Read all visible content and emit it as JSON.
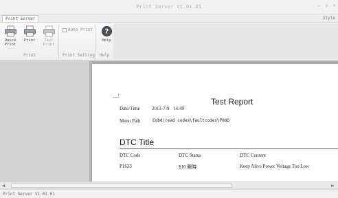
{
  "window": {
    "title": "Print Server V1.01.01"
  },
  "tabs": [
    {
      "label": "Print Server"
    }
  ],
  "style_label": "Style",
  "ribbon": {
    "quick_print": "Quick Print",
    "print": "Print",
    "text_print": "Text Print",
    "auto_print": "Auto Print",
    "help": "Help",
    "groups": [
      "Print",
      "Print Setting",
      "Help"
    ]
  },
  "report": {
    "title": "Test Report",
    "date_label": "Date/Time",
    "date_value": "2011-7-9",
    "time_value": "14:49",
    "menu_label": "Menu Path",
    "menu_value": "Eobd\\read codes\\faultcodes\\P08D",
    "dtc_title": "DTC Title",
    "columns": [
      "DTC Code",
      "DTC Status",
      "DTC Content"
    ],
    "rows": [
      {
        "code": "P1633",
        "status": "$10 瞬時",
        "content": "Keep Alive Power Voltage Too Low"
      }
    ]
  },
  "status": {
    "text": "Print Server V1.01.01"
  },
  "colors": {
    "page_bg": "#ffffff",
    "workspace": "#bdbdbd",
    "ribbon": "#f5f5f5"
  }
}
